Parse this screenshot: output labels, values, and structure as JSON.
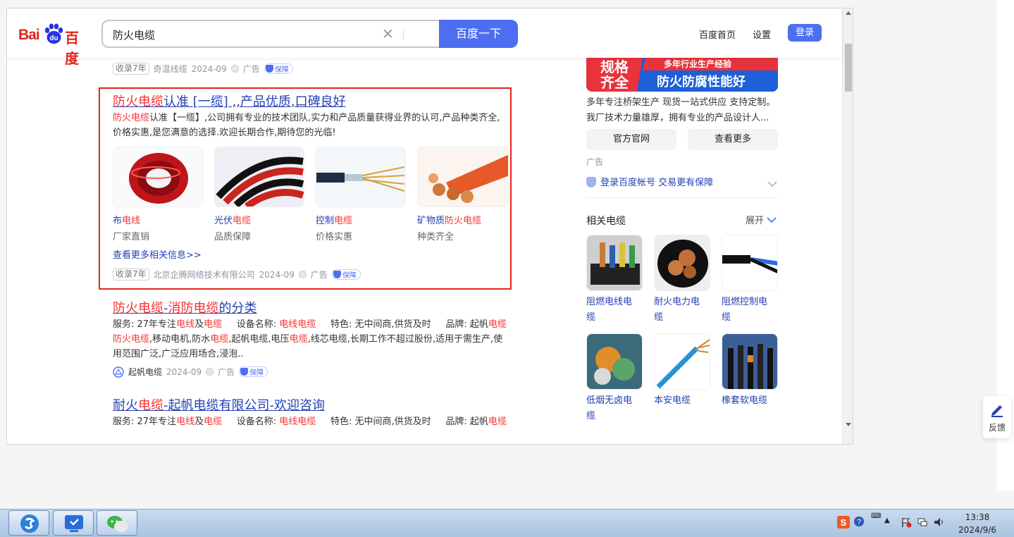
{
  "header": {
    "logo_bai": "Bai",
    "logo_du": "du",
    "logo_cn": "百度",
    "search_value": "防火电缆",
    "search_button": "百度一下",
    "nav_home": "百度首页",
    "nav_settings": "设置",
    "login": "登录"
  },
  "meta_common": {
    "ad": "广告",
    "guarantee": "保障"
  },
  "result0_meta": {
    "age": "收录7年",
    "source": "奇温线缆",
    "date": "2024-09"
  },
  "result1": {
    "title_red": "防火电缆",
    "title_rest": "认准 [一缆] ,,产品优质,口碑良好",
    "desc_red": "防火电缆",
    "desc_line1": "认准【一缆】,公司拥有专业的技术团队,实力和产品质量获得业界的认可,产品种类齐全,",
    "desc_line2": "价格实惠,是您满意的选择.欢迎长期合作,期待您的光临!",
    "products": [
      {
        "name_a": "布",
        "name_b": "电线",
        "sub": "厂家直销"
      },
      {
        "name_a": "光伏",
        "name_b": "电缆",
        "sub": "品质保障"
      },
      {
        "name_a": "控制",
        "name_b": "电缆",
        "sub": "价格实惠"
      },
      {
        "name_a": "矿物质",
        "name_b": "防火电缆",
        "sub": "种类齐全"
      }
    ],
    "more": "查看更多相关信息>>",
    "meta": {
      "age": "收录7年",
      "source": "北京企腾网络技术有限公司",
      "date": "2024-09"
    }
  },
  "result2": {
    "title_a": "防火电缆",
    "title_b": "-",
    "title_c": "消防电缆",
    "title_d": "的分类",
    "line1": {
      "service_label": "服务: 27年专注",
      "s1": "电线",
      "and": "及",
      "s2": "电缆",
      "device_label": "设备名称: ",
      "device_val": "电线电缆",
      "feature": "特色: 无中间商,供货及时",
      "brand_label": "品牌: 起帆",
      "brand_red": "电缆"
    },
    "line2_a": "防火电缆",
    "line2_b": ",移动电机,防水",
    "line2_c": "电缆",
    "line2_d": ",起帆电缆,电压",
    "line2_e": "电缆",
    "line2_f": ",线芯电缆,长期工作不超过股份,适用于需生产,使",
    "line3": "用范围广泛,广泛应用场合,浸泡..",
    "meta": {
      "source": "起帆电缆",
      "date": "2024-09"
    }
  },
  "result3": {
    "title_a": "耐火",
    "title_b": "电缆",
    "title_c": "-起帆电缆有限公司-欢迎咨询",
    "line1": {
      "service_label": "服务: 27年专注",
      "s1": "电线",
      "and": "及",
      "s2": "电缆",
      "device_label": "设备名称: ",
      "device_val": "电线电缆",
      "feature": "特色: 无中间商,供货及时",
      "brand_label": "品牌: 起帆",
      "brand_red": "电缆"
    }
  },
  "right": {
    "banner_left_1": "规格",
    "banner_left_2": "齐全",
    "banner_right_1": "多年行业生产经验",
    "banner_right_2": "防火防腐性能好",
    "text1": "多年专注桥架生产 现货一站式供应 支持定制。",
    "text2": "我厂技术力量雄厚，拥有专业的产品设计人...",
    "btn_official": "官方官网",
    "btn_more": "查看更多",
    "ad": "广告",
    "login_tip": "登录百度帐号 交易更有保障",
    "related_title": "相关电缆",
    "expand": "展开",
    "related": [
      {
        "l1": "阻燃电线电",
        "l2": "缆"
      },
      {
        "l1": "耐火电力电",
        "l2": "缆"
      },
      {
        "l1": "阻燃控制电",
        "l2": "缆"
      },
      {
        "l1": "低烟无卤电",
        "l2": "缆"
      },
      {
        "l1": "本安电缆",
        "l2": ""
      },
      {
        "l1": "橡套软电缆",
        "l2": ""
      }
    ]
  },
  "feedback": "反馈",
  "taskbar": {
    "time": "13:38",
    "date": "2024/9/6"
  }
}
